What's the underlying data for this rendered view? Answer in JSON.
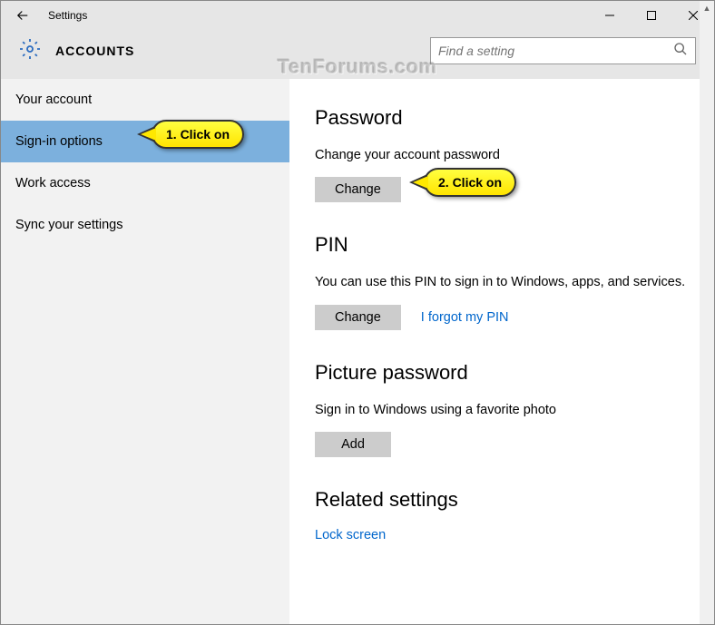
{
  "titlebar": {
    "title": "Settings"
  },
  "header": {
    "page_title": "ACCOUNTS",
    "search_placeholder": "Find a setting"
  },
  "sidebar": {
    "items": [
      {
        "label": "Your account"
      },
      {
        "label": "Sign-in options"
      },
      {
        "label": "Work access"
      },
      {
        "label": "Sync your settings"
      }
    ]
  },
  "content": {
    "password": {
      "title": "Password",
      "desc": "Change your account password",
      "button": "Change"
    },
    "pin": {
      "title": "PIN",
      "desc": "You can use this PIN to sign in to Windows, apps, and services.",
      "button": "Change",
      "link": "I forgot my PIN"
    },
    "picture": {
      "title": "Picture password",
      "desc": "Sign in to Windows using a favorite photo",
      "button": "Add"
    },
    "related": {
      "title": "Related settings",
      "link": "Lock screen"
    }
  },
  "callouts": {
    "c1": "1. Click on",
    "c2": "2. Click on"
  },
  "watermark": "TenForums.com"
}
